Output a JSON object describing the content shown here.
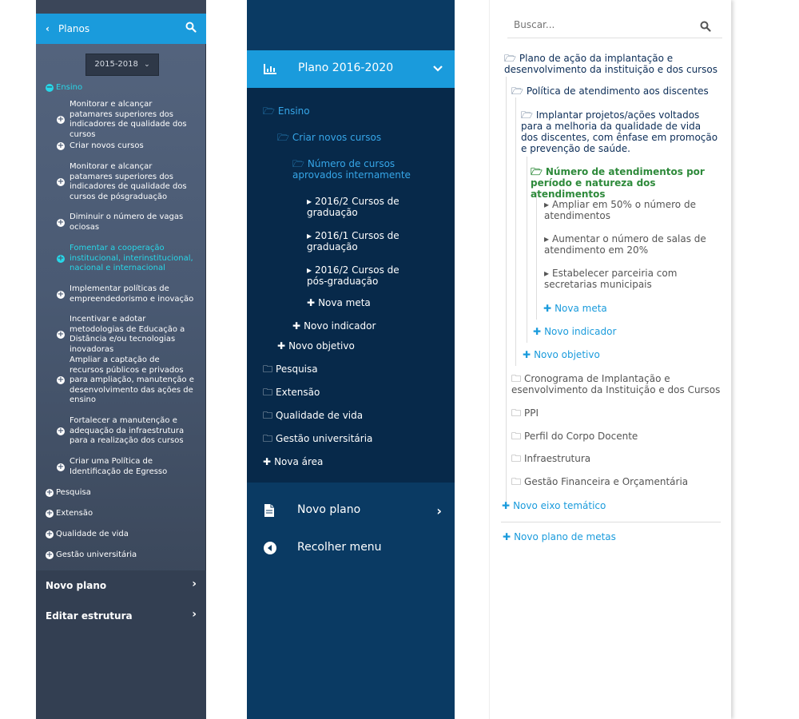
{
  "panel1": {
    "header_title": "Planos",
    "year_selector": "2015-2018",
    "area_active": "Ensino",
    "objectives": [
      "Monitorar e alcançar patamares superiores dos indicadores de qualidade dos cursos",
      "Criar novos cursos",
      "Monitorar e alcançar patamares superiores dos indicadores de qualidade dos cursos de pósgraduação",
      "Diminuir o número de vagas ociosas",
      "Fomentar a cooperação institucional, interinstitucional, nacional e internacional",
      "Implementar políticas de empreendedorismo e inovação",
      "Incentivar e adotar metodologias de Educação a Distância e/ou tecnologias inovadoras",
      "Ampliar a captação de recursos públicos e privados para ampliação, manutenção e desenvolvimento das ações de ensino",
      "Fortalecer a manutenção e adequação da infraestrutura para a realização dos cursos",
      "Criar uma Política de Identificação de Egresso"
    ],
    "other_areas": [
      "Pesquisa",
      "Extensão",
      "Qualidade de vida",
      "Gestão universitária"
    ],
    "bottom": [
      "Novo plano",
      "Editar estrutura"
    ]
  },
  "panel2": {
    "header_title": "Plano 2016-2020",
    "area": "Ensino",
    "objective": "Criar novos cursos",
    "indicator": "Número de cursos aprovados internamente",
    "goals": [
      "2016/2 Cursos de graduação",
      "2016/1 Cursos de graduação",
      "2016/2 Cursos de pós-graduação"
    ],
    "new_goal": "Nova meta",
    "new_indicator": "Novo indicador",
    "new_objective": "Novo objetivo",
    "other_areas": [
      "Pesquisa",
      "Extensão",
      "Qualidade de vida",
      "Gestão universitária"
    ],
    "new_area": "Nova área",
    "bottom": {
      "new_plan": "Novo plano",
      "collapse": "Recolher menu"
    }
  },
  "panel3": {
    "search_placeholder": "Buscar...",
    "plan_title": "Plano de ação da implantação e desenvolvimento da instituição e dos cursos",
    "policy": "Política de atendimento aos discentes",
    "project": "Implantar projetos/ações voltados para a melhoria da qualidade de vida dos discentes, com ênfase em promoção e prevenção de saúde.",
    "indicator": "Número de atendimentos por período e natureza dos atendimentos",
    "goals": [
      "Ampliar em 50% o número de atendimentos",
      "Aumentar o número de salas de atendimento em 20%",
      "Estabelecer parceiria com secretarias municipais"
    ],
    "new_goal": "Nova meta",
    "new_indicator": "Novo indicador",
    "new_objective": "Novo objetivo",
    "themes": [
      "Cronograma de Implantação e esenvolvimento da Instituição e dos Cursos",
      "PPI",
      "Perfil do Corpo Docente",
      "Infraestrutura",
      "Gestão Financeira e Orçamentária"
    ],
    "new_theme": "Novo eixo temático",
    "new_plan": "Novo plano de metas"
  }
}
